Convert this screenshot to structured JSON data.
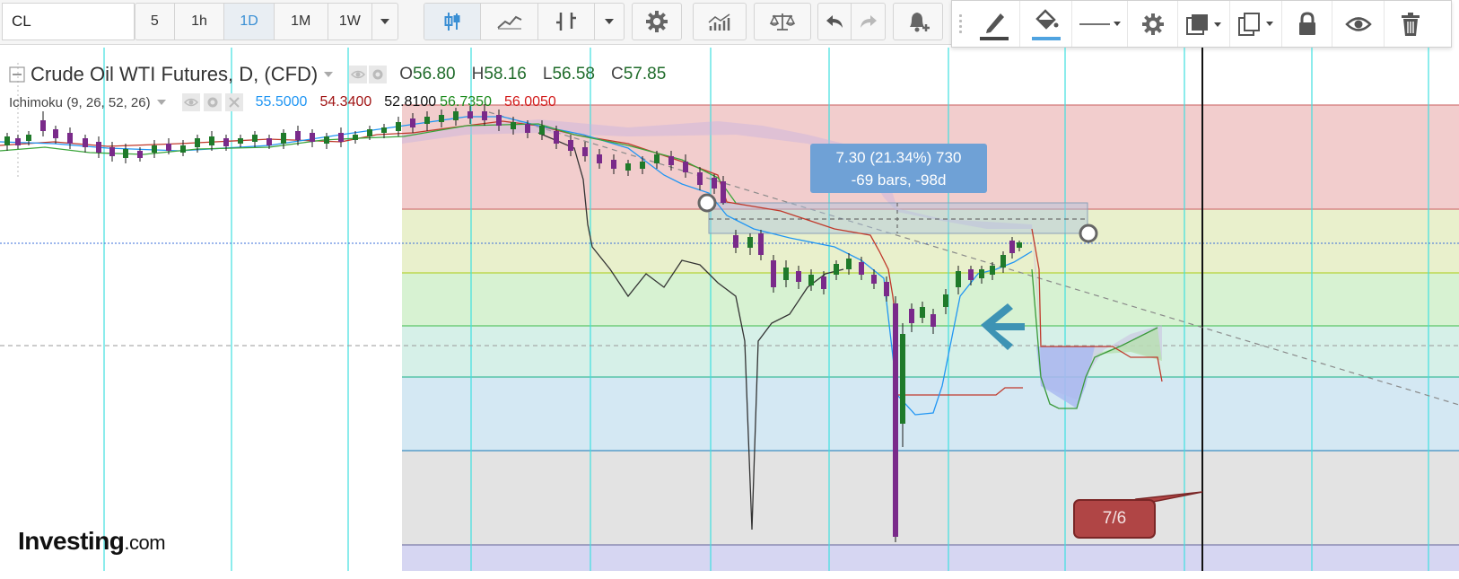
{
  "toolbar": {
    "symbol": "CL",
    "intervals": [
      "5",
      "1h",
      "1D",
      "1M",
      "1W"
    ],
    "active_interval": "1D"
  },
  "legend": {
    "title": "Crude Oil WTI Futures, D, (CFD)",
    "open_label": "O",
    "open": "56.80",
    "high_label": "H",
    "high": "58.16",
    "low_label": "L",
    "low": "56.58",
    "close_label": "C",
    "close": "57.85"
  },
  "indicator": {
    "name": "Ichimoku (9, 26, 52, 26)",
    "values": [
      {
        "text": "55.5000",
        "color": "#2196f3"
      },
      {
        "text": "54.3400",
        "color": "#a11515"
      },
      {
        "text": "52.8100",
        "color": "#111111"
      },
      {
        "text": "56.7350",
        "color": "#1b8a1b"
      },
      {
        "text": "56.0050",
        "color": "#d21a1a"
      }
    ]
  },
  "measure": {
    "line1": "7.30 (21.34%) 730",
    "line2": "-69 bars, -98d"
  },
  "date_label": "7/6",
  "logo": {
    "name": "Investing",
    "suffix": ".com"
  },
  "colors": {
    "vertical_grid": "#3fe0e0",
    "fib_red": "#f2cdcd",
    "fib_yellow": "#e9f0cc",
    "fib_green": "#d7f2d2",
    "fib_teal": "#d6f0e8",
    "fib_blue": "#d4e8f3",
    "fib_gray": "#e3e3e3",
    "fib_purple": "#d6d6f2",
    "candle_up": "#1f7a2a",
    "candle_down": "#7a2a8a",
    "arrow": "#3d93b4"
  },
  "icons": [
    "candle-style-icon",
    "line-style-icon",
    "bar-compare-icon",
    "settings-icon",
    "indicators-icon",
    "balance-icon",
    "undo-icon",
    "redo-icon",
    "alert-icon",
    "pencil-icon",
    "fill-bucket-icon",
    "line-width-icon",
    "gear-icon",
    "layers-icon",
    "clone-icon",
    "lock-icon",
    "eye-icon",
    "trash-icon"
  ]
}
